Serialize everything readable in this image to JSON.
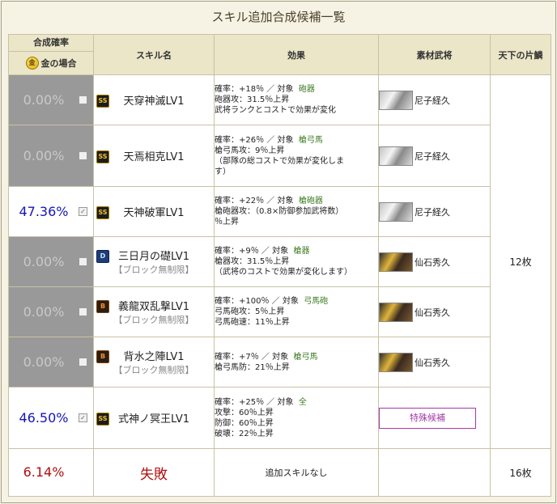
{
  "title": "スキル追加合成候補一覧",
  "headers": {
    "rate_top": "合成確率",
    "rate_gold_icon": "金",
    "rate_bottom": "金の場合",
    "skill": "スキル名",
    "effect": "効果",
    "material": "素材武将",
    "shards": "天下の片鱗"
  },
  "rows": [
    {
      "rate": "0.00%",
      "checked": false,
      "badge": "SS",
      "skill": "天穿神滅LV1",
      "sub": "",
      "effect": [
        "確率：+18％ ／ 対象",
        "砲器",
        "砲器攻：31.5％上昇",
        "武将ランクとコストで効果が変化"
      ],
      "material": "尼子経久"
    },
    {
      "rate": "0.00%",
      "checked": false,
      "badge": "SS",
      "skill": "天焉相克LV1",
      "sub": "",
      "effect": [
        "確率：+26％ ／ 対象",
        "槍弓馬",
        "槍弓馬攻：9％上昇",
        "（部隊の総コストで効果が変化しま",
        "す）"
      ],
      "material": "尼子経久"
    },
    {
      "rate": "47.36%",
      "checked": true,
      "badge": "SS",
      "skill": "天神破軍LV1",
      "sub": "",
      "effect": [
        "確率：+22％ ／ 対象",
        "槍砲器",
        "槍砲器攻：（0.8×防御参加武将数）",
        "％上昇"
      ],
      "material": "尼子経久"
    },
    {
      "rate": "0.00%",
      "checked": false,
      "badge": "D",
      "skill": "三日月の礎LV1",
      "sub": "【ブロック無制限】",
      "effect": [
        "確率：+9％ ／ 対象",
        "槍器",
        "槍器攻：31.5％上昇",
        "（武将のコストで効果が変化します）"
      ],
      "material": "仙石秀久"
    },
    {
      "rate": "0.00%",
      "checked": false,
      "badge": "B",
      "skill": "義龍双乱撃LV1",
      "sub": "【ブロック無制限】",
      "effect": [
        "確率：+100％ ／ 対象",
        "弓馬砲",
        "弓馬砲攻：5％上昇",
        "弓馬砲速：11％上昇"
      ],
      "material": "仙石秀久"
    },
    {
      "rate": "0.00%",
      "checked": false,
      "badge": "B",
      "skill": "背水之陣LV1",
      "sub": "【ブロック無制限】",
      "effect": [
        "確率：+7％ ／ 対象",
        "槍弓馬",
        "槍弓馬防：21％上昇"
      ],
      "material": "仙石秀久"
    },
    {
      "rate": "46.50%",
      "checked": true,
      "badge": "SS",
      "skill": "式神ノ冥王LV1",
      "sub": "",
      "effect": [
        "確率：+25％ ／ 対象",
        "全",
        "攻撃：60％上昇",
        "防御：60％上昇",
        "破壊：22％上昇"
      ],
      "material_button": "特殊候補"
    }
  ],
  "shards_top": "12枚",
  "fail_row": {
    "rate": "6.14%",
    "label": "失敗",
    "effect": "追加スキルなし",
    "shards": "16枚"
  },
  "check_mark": "✓"
}
